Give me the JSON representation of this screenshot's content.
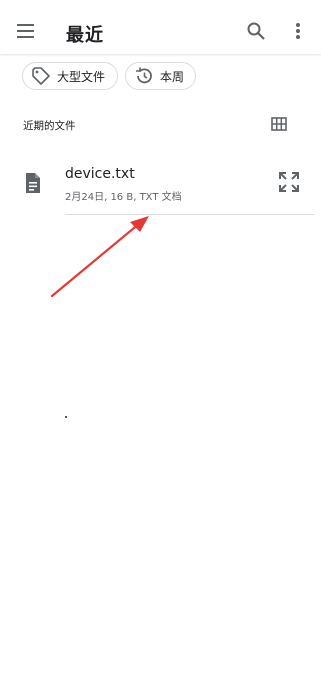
{
  "appbar": {
    "title": "最近",
    "menu_icon": "menu-icon",
    "search_icon": "search-icon",
    "more_icon": "more-vert-icon"
  },
  "chips": [
    {
      "label": "大型文件",
      "icon": "tag-icon"
    },
    {
      "label": "本周",
      "icon": "history-icon"
    }
  ],
  "section": {
    "title": "近期的文件",
    "view_toggle_icon": "grid-view-icon"
  },
  "files": [
    {
      "name": "device.txt",
      "meta": "2月24日, 16 B, TXT 文档",
      "icon": "document-icon",
      "action_icon": "expand-icon"
    }
  ],
  "annotation": {
    "color": "#e53935"
  }
}
